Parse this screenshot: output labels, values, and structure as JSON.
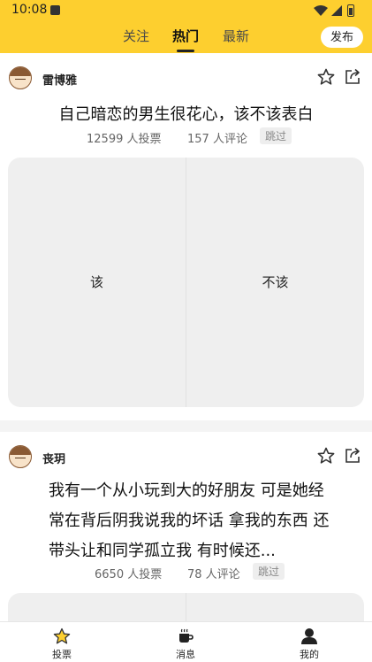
{
  "status_bar": {
    "time": "10:08"
  },
  "header": {
    "tabs": [
      {
        "label": "关注",
        "active": false
      },
      {
        "label": "热门",
        "active": true
      },
      {
        "label": "最新",
        "active": false
      }
    ],
    "publish_label": "发布"
  },
  "posts": [
    {
      "author": "雷博雅",
      "question": "自己暗恋的男生很花心，该不该表白",
      "votes": "12599 人投票",
      "comments": "157 人评论",
      "skip_label": "跳过",
      "options": [
        "该",
        "不该"
      ]
    },
    {
      "author": "丧玥",
      "question": "我有一个从小玩到大的好朋友 可是她经常在背后阴我说我的坏话 拿我的东西 还带头让和同学孤立我 有时候还...",
      "votes": "6650 人投票",
      "comments": "78 人评论",
      "skip_label": "跳过"
    }
  ],
  "bottom_nav": [
    {
      "label": "投票",
      "icon": "star-icon",
      "active": true
    },
    {
      "label": "消息",
      "icon": "cup-icon",
      "active": false
    },
    {
      "label": "我的",
      "icon": "person-icon",
      "active": false
    }
  ],
  "colors": {
    "accent": "#fdcf2f",
    "background": "#f4f4f4",
    "option_bg": "#efefef"
  }
}
